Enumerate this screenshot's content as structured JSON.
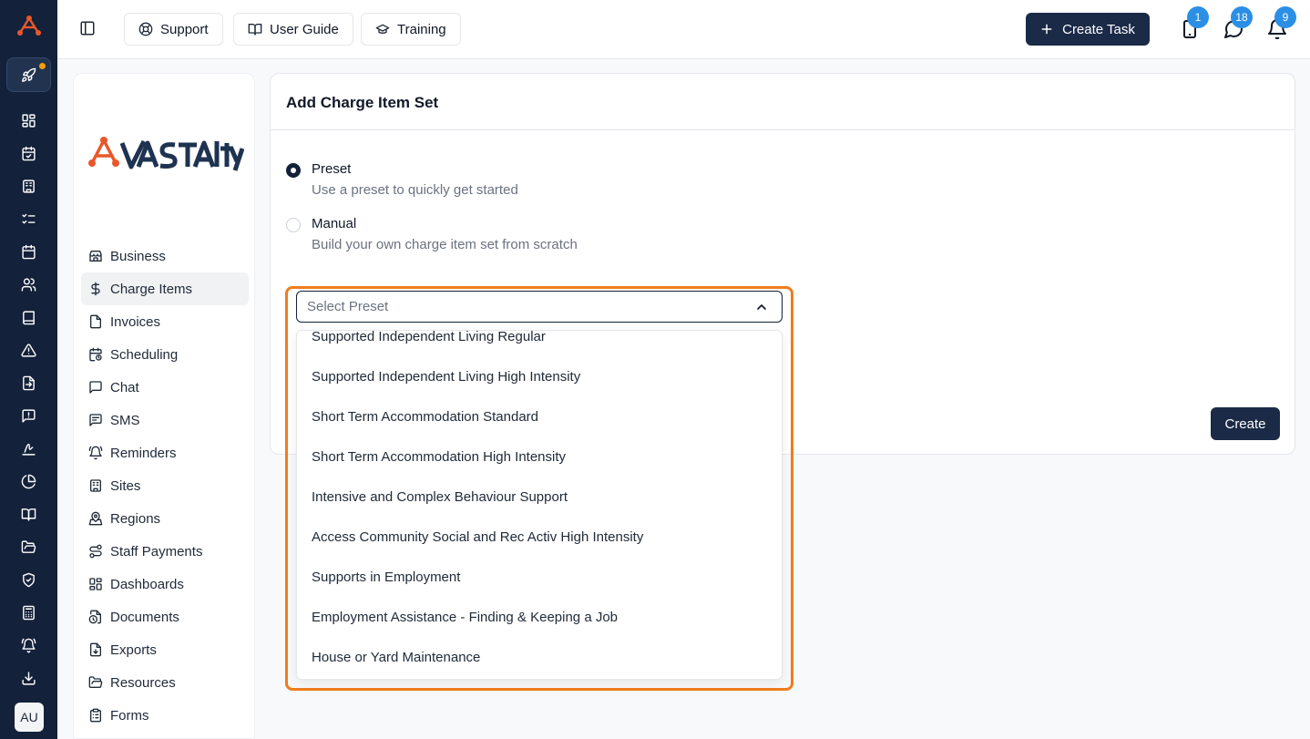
{
  "topbar": {
    "buttons": [
      {
        "label": "Support",
        "icon": "lifebuoy-icon"
      },
      {
        "label": "User Guide",
        "icon": "book-open-icon"
      },
      {
        "label": "Training",
        "icon": "graduation-cap-icon"
      }
    ],
    "create_task_label": "Create Task",
    "badges": {
      "devices": "1",
      "messages": "18",
      "notifications": "9"
    }
  },
  "rail": {
    "icons": [
      "layout-grid-icon",
      "calendar-check-icon",
      "building-icon",
      "list-checks-icon",
      "calendar-icon",
      "users-icon",
      "book-icon",
      "alert-triangle-icon",
      "file-export-icon",
      "message-alert-icon",
      "signature-icon",
      "pie-chart-icon",
      "book-open-icon",
      "folder-open-icon",
      "shield-check-icon",
      "calculator-icon",
      "bell-ring-icon",
      "download-icon"
    ],
    "avatar_initials": "AU"
  },
  "settings_nav": {
    "items": [
      {
        "label": "Business",
        "icon": "store-icon"
      },
      {
        "label": "Charge Items",
        "icon": "dollar-icon",
        "active": true
      },
      {
        "label": "Invoices",
        "icon": "file-icon"
      },
      {
        "label": "Scheduling",
        "icon": "calendar-clock-icon"
      },
      {
        "label": "Chat",
        "icon": "message-square-icon"
      },
      {
        "label": "SMS",
        "icon": "message-text-icon"
      },
      {
        "label": "Reminders",
        "icon": "bell-ring-icon"
      },
      {
        "label": "Sites",
        "icon": "building-icon"
      },
      {
        "label": "Regions",
        "icon": "map-pin-icon"
      },
      {
        "label": "Staff Payments",
        "icon": "route-icon"
      },
      {
        "label": "Dashboards",
        "icon": "layout-grid-icon"
      },
      {
        "label": "Documents",
        "icon": "file-clock-icon"
      },
      {
        "label": "Exports",
        "icon": "file-down-icon"
      },
      {
        "label": "Resources",
        "icon": "folder-open-icon"
      },
      {
        "label": "Forms",
        "icon": "clipboard-list-icon"
      }
    ]
  },
  "card": {
    "title": "Add Charge Item Set",
    "preset": {
      "title": "Preset",
      "description": "Use a preset to quickly get started",
      "selected": true
    },
    "manual": {
      "title": "Manual",
      "description": "Build your own charge item set from scratch",
      "selected": false
    },
    "select_placeholder": "Select Preset",
    "create_label": "Create"
  },
  "dropdown": {
    "options": [
      "Supported Independent Living Regular",
      "Supported Independent Living High Intensity",
      "Short Term Accommodation Standard",
      "Short Term Accommodation High Intensity",
      "Intensive and Complex Behaviour Support",
      "Access Community Social and Rec Activ High Intensity",
      "Supports in Employment",
      "Employment Assistance - Finding & Keeping a Job",
      "House or Yard Maintenance"
    ]
  },
  "colors": {
    "navy": "#13213a",
    "accent_button": "#1a2a47",
    "highlight": "#f07c1e",
    "badge": "#2b8fe6",
    "brand_orange": "#e9572b",
    "brand_navy": "#1e3350"
  }
}
